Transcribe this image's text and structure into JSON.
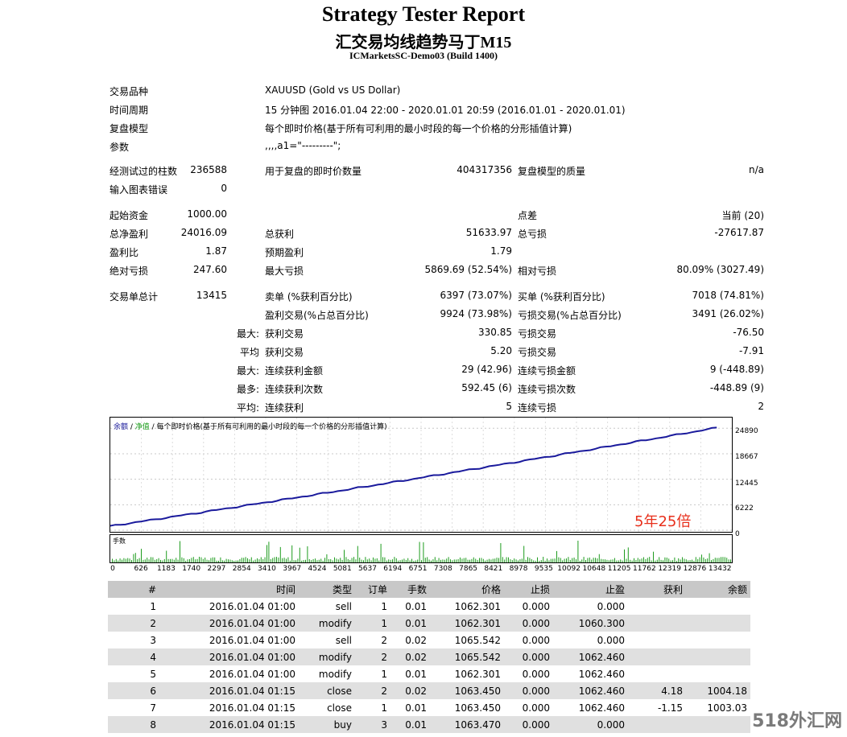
{
  "header": {
    "title": "Strategy Tester Report",
    "subtitle": "汇交易均线趋势马丁M15",
    "server": "ICMarketsSC-Demo03 (Build 1400)"
  },
  "info": {
    "symbol_label": "交易品种",
    "symbol_value": "XAUUSD (Gold vs US Dollar)",
    "period_label": "时间周期",
    "period_value": "15 分钟图 2016.01.04 22:00 - 2020.01.01 20:59 (2016.01.01 - 2020.01.01)",
    "model_label": "复盘模型",
    "model_value": "每个即时价格(基于所有可利用的最小时段的每一个价格的分形插值计算)",
    "params_label": "参数",
    "params_value": ",,,,a1=\"---------\";"
  },
  "stats": {
    "bars_label": "经测试过的柱数",
    "bars_value": "236588",
    "ticks_label": "用于复盘的即时价数量",
    "ticks_value": "404317356",
    "quality_label": "复盘模型的质量",
    "quality_value": "n/a",
    "errors_label": "输入图表错误",
    "errors_value": "0",
    "deposit_label": "起始资金",
    "deposit_value": "1000.00",
    "spread_label": "点差",
    "spread_value": "当前 (20)",
    "net_label": "总净盈利",
    "net_value": "24016.09",
    "gross_profit_label": "总获利",
    "gross_profit_value": "51633.97",
    "gross_loss_label": "总亏损",
    "gross_loss_value": "-27617.87",
    "pf_label": "盈利比",
    "pf_value": "1.87",
    "ep_label": "预期盈利",
    "ep_value": "1.79",
    "abs_dd_label": "绝对亏损",
    "abs_dd_value": "247.60",
    "max_dd_label": "最大亏损",
    "max_dd_value": "5869.69 (52.54%)",
    "rel_dd_label": "相对亏损",
    "rel_dd_value": "80.09% (3027.49)",
    "total_label": "交易单总计",
    "total_value": "13415",
    "short_label": "卖单 (%获利百分比)",
    "short_value": "6397 (73.07%)",
    "long_label": "买单 (%获利百分比)",
    "long_value": "7018 (74.81%)",
    "win_label": "盈利交易(%占总百分比)",
    "win_value": "9924 (73.98%)",
    "loss_label": "亏损交易(%占总百分比)",
    "loss_value": "3491 (26.02%)",
    "r1_pre": "最大:",
    "r1_a_label": "获利交易",
    "r1_a_value": "330.85",
    "r1_b_label": "亏损交易",
    "r1_b_value": "-76.50",
    "r2_pre": "平均",
    "r2_a_label": "获利交易",
    "r2_a_value": "5.20",
    "r2_b_label": "亏损交易",
    "r2_b_value": "-7.91",
    "r3_pre": "最大:",
    "r3_a_label": "连续获利金额",
    "r3_a_value": "29 (42.96)",
    "r3_b_label": "连续亏损金额",
    "r3_b_value": "9 (-448.89)",
    "r4_pre": "最多:",
    "r4_a_label": "连续获利次数",
    "r4_a_value": "592.45 (6)",
    "r4_b_label": "连续亏损次数",
    "r4_b_value": "-448.89 (9)",
    "r5_pre": "平均:",
    "r5_a_label": "连续获利",
    "r5_a_value": "5",
    "r5_b_label": "连续亏损",
    "r5_b_value": "2"
  },
  "chart_data": {
    "type": "line",
    "legend_balance": "余额",
    "legend_sep1": " / ",
    "legend_equity": "净值",
    "legend_rest": " / 每个即时价格(基于所有可利用的最小时段的每一个价格的分形插值计算)",
    "series": [
      {
        "name": "余额",
        "color": "#1a1a9c"
      }
    ],
    "x": [
      0,
      13415
    ],
    "y": [
      1000,
      25016
    ],
    "ylim": [
      0,
      27112
    ],
    "yticks": [
      "24890",
      "18667",
      "12445",
      "6222",
      "0"
    ],
    "ytick_values": [
      24890,
      18667,
      12445,
      6222,
      0
    ],
    "annotation": "5年25倍",
    "volume_label": "手数",
    "xticks": [
      "0",
      "626",
      "1183",
      "1740",
      "2297",
      "2854",
      "3410",
      "3967",
      "4524",
      "5081",
      "5637",
      "6194",
      "6751",
      "7308",
      "7865",
      "8421",
      "8978",
      "9535",
      "10092",
      "10648",
      "11205",
      "11762",
      "12319",
      "12876",
      "13432"
    ],
    "xlim": [
      0,
      13750
    ]
  },
  "trades": {
    "headers": [
      "#",
      "时间",
      "类型",
      "订单",
      "手数",
      "价格",
      "止损",
      "止盈",
      "获利",
      "余额"
    ],
    "rows": [
      [
        "1",
        "2016.01.04 01:00",
        "sell",
        "1",
        "0.01",
        "1062.301",
        "0.000",
        "0.000",
        "",
        ""
      ],
      [
        "2",
        "2016.01.04 01:00",
        "modify",
        "1",
        "0.01",
        "1062.301",
        "0.000",
        "1060.300",
        "",
        ""
      ],
      [
        "3",
        "2016.01.04 01:00",
        "sell",
        "2",
        "0.02",
        "1065.542",
        "0.000",
        "0.000",
        "",
        ""
      ],
      [
        "4",
        "2016.01.04 01:00",
        "modify",
        "2",
        "0.02",
        "1065.542",
        "0.000",
        "1062.460",
        "",
        ""
      ],
      [
        "5",
        "2016.01.04 01:00",
        "modify",
        "1",
        "0.01",
        "1062.301",
        "0.000",
        "1062.460",
        "",
        ""
      ],
      [
        "6",
        "2016.01.04 01:15",
        "close",
        "2",
        "0.02",
        "1063.450",
        "0.000",
        "1062.460",
        "4.18",
        "1004.18"
      ],
      [
        "7",
        "2016.01.04 01:15",
        "close",
        "1",
        "0.01",
        "1063.450",
        "0.000",
        "1062.460",
        "-1.15",
        "1003.03"
      ],
      [
        "8",
        "2016.01.04 01:15",
        "buy",
        "3",
        "0.01",
        "1063.470",
        "0.000",
        "0.000",
        "",
        ""
      ]
    ]
  },
  "watermark": "518外汇网"
}
